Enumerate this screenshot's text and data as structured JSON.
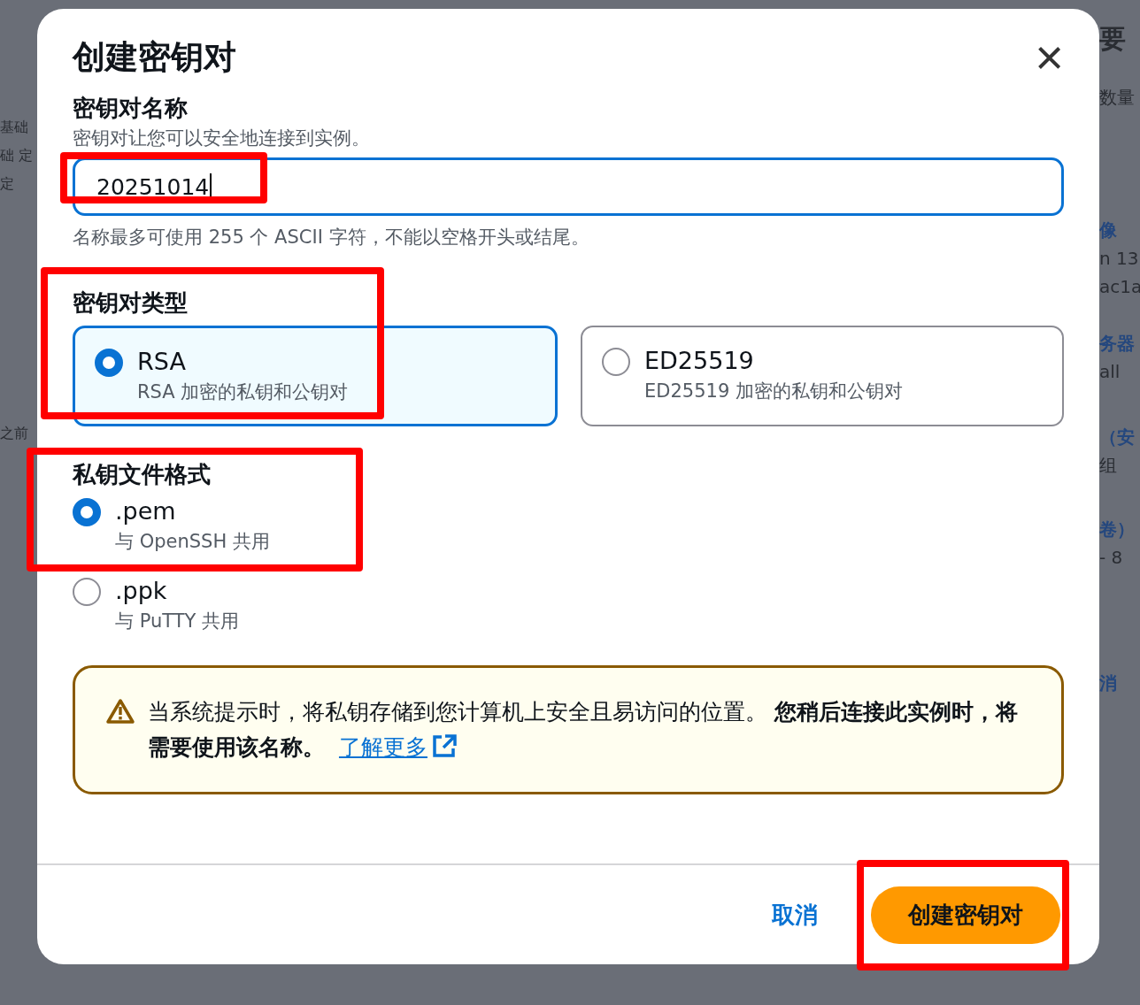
{
  "background": {
    "left": [
      {
        "text": "基础",
        "kind": "text"
      },
      {
        "text": "础 定",
        "kind": "text"
      },
      {
        "text": "定",
        "kind": "text"
      },
      {
        "text": "之前",
        "kind": "text"
      }
    ],
    "right": [
      {
        "text": "要",
        "kind": "heading"
      },
      {
        "text": "数量",
        "kind": "text"
      },
      {
        "text": "像",
        "kind": "link"
      },
      {
        "text": "n 13",
        "kind": "text"
      },
      {
        "text": "ac1a",
        "kind": "small"
      },
      {
        "text": "务器",
        "kind": "link"
      },
      {
        "text": "all",
        "kind": "text"
      },
      {
        "text": "（安",
        "kind": "link"
      },
      {
        "text": "组",
        "kind": "text"
      },
      {
        "text": "卷）",
        "kind": "link"
      },
      {
        "text": "- 8",
        "kind": "text"
      },
      {
        "text": "消",
        "kind": "link"
      }
    ]
  },
  "dialog": {
    "title": "创建密钥对",
    "close": "×",
    "name_field": {
      "label": "密钥对名称",
      "description": "密钥对让您可以安全地连接到实例。",
      "value": "20251014",
      "focused": true,
      "hint": "名称最多可使用 255 个 ASCII 字符，不能以空格开头或结尾。",
      "highlighted": true
    },
    "key_type": {
      "label": "密钥对类型",
      "highlighted": true,
      "options": [
        {
          "label": "RSA",
          "description": "RSA 加密的私钥和公钥对",
          "selected": true
        },
        {
          "label": "ED25519",
          "description": "ED25519 加密的私钥和公钥对",
          "selected": false
        }
      ]
    },
    "file_format": {
      "label": "私钥文件格式",
      "highlighted": true,
      "options": [
        {
          "label": ".pem",
          "description": "与 OpenSSH 共用",
          "selected": true
        },
        {
          "label": ".ppk",
          "description": "与 PuTTY 共用",
          "selected": false
        }
      ]
    },
    "alert": {
      "text": "当系统提示时，将私钥存储到您计算机上安全且易访问的位置。 **您稍后连接此实例时，将需要使用该名称。**",
      "link": "了解更多"
    },
    "buttons": [
      {
        "label": "取消",
        "kind": "link",
        "highlighted": false
      },
      {
        "label": "创建密钥对",
        "kind": "primary",
        "highlighted": true
      }
    ]
  }
}
